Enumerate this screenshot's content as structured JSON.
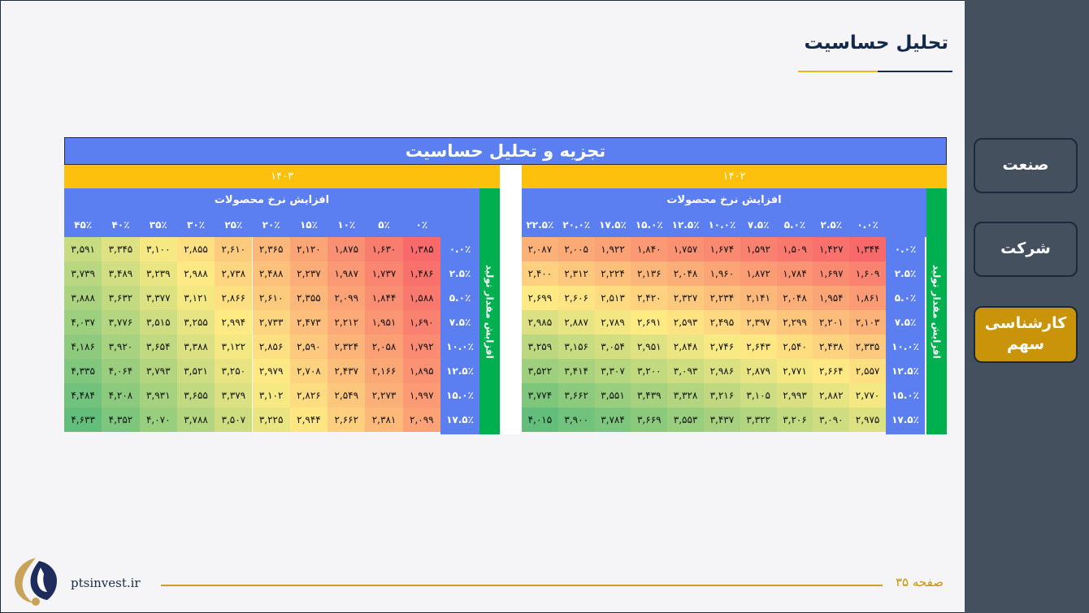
{
  "page": {
    "title": "تحلیل حساسیت",
    "footer_site": "ptsinvest.ir",
    "footer_page": "صفحه ۳۵"
  },
  "nav": {
    "items": [
      {
        "label": "صنعت",
        "active": false
      },
      {
        "label": "شرکت",
        "active": false
      },
      {
        "label": "کارشناسی\nسهم",
        "active": true
      }
    ]
  },
  "colors": {
    "header_blue": "#5b7ff0",
    "year_gold": "#fdc10d",
    "strip_green": "#00b050",
    "sidebar": "#44505e",
    "active_nav": "#c9940a",
    "scale_low": "#f8696b",
    "scale_mid": "#ffeb84",
    "scale_high": "#63be7b"
  },
  "table": {
    "title": "تجزیه و تحلیل حساسیت",
    "col_header": "افزایش نرخ محصولات",
    "row_header": "افزایش مقدار تولید",
    "row_labels": [
      "۰.۰٪",
      "۲.۵٪",
      "۵.۰٪",
      "۷.۵٪",
      "۱۰.۰٪",
      "۱۲.۵٪",
      "۱۵.۰٪",
      "۱۷.۵٪"
    ],
    "right": {
      "year": "۱۴۰۲",
      "col_labels": [
        "۰.۰٪",
        "۲.۵٪",
        "۵.۰٪",
        "۷.۵٪",
        "۱۰.۰٪",
        "۱۲.۵٪",
        "۱۵.۰٪",
        "۱۷.۵٪",
        "۲۰.۰٪",
        "۲۲.۵٪"
      ],
      "values": [
        [
          1344,
          1427,
          1509,
          1592,
          1674,
          1757,
          1840,
          1922,
          2005,
          2087
        ],
        [
          1609,
          1697,
          1784,
          1872,
          1960,
          2048,
          2136,
          2224,
          2312,
          2400
        ],
        [
          1861,
          1954,
          2048,
          2141,
          2234,
          2327,
          2420,
          2513,
          2606,
          2699
        ],
        [
          2103,
          2201,
          2299,
          2397,
          2495,
          2593,
          2691,
          2789,
          2887,
          2985
        ],
        [
          2335,
          2438,
          2540,
          2643,
          2746,
          2848,
          2951,
          3054,
          3156,
          3259
        ],
        [
          2557,
          2664,
          2771,
          2879,
          2986,
          3093,
          3200,
          3307,
          3414,
          3522
        ],
        [
          2770,
          2882,
          2993,
          3105,
          3216,
          3328,
          3439,
          3551,
          3662,
          3774
        ],
        [
          2975,
          3090,
          3206,
          3322,
          3437,
          3553,
          3669,
          3784,
          3900,
          4015
        ]
      ],
      "display": [
        [
          "۱,۳۴۴",
          "۱,۴۲۷",
          "۱,۵۰۹",
          "۱,۵۹۲",
          "۱,۶۷۴",
          "۱,۷۵۷",
          "۱,۸۴۰",
          "۱,۹۲۲",
          "۲,۰۰۵",
          "۲,۰۸۷"
        ],
        [
          "۱,۶۰۹",
          "۱,۶۹۷",
          "۱,۷۸۴",
          "۱,۸۷۲",
          "۱,۹۶۰",
          "۲,۰۴۸",
          "۲,۱۳۶",
          "۲,۲۲۴",
          "۲,۳۱۲",
          "۲,۴۰۰"
        ],
        [
          "۱,۸۶۱",
          "۱,۹۵۴",
          "۲,۰۴۸",
          "۲,۱۴۱",
          "۲,۲۳۴",
          "۲,۳۲۷",
          "۲,۴۲۰",
          "۲,۵۱۳",
          "۲,۶۰۶",
          "۲,۶۹۹"
        ],
        [
          "۲,۱۰۳",
          "۲,۲۰۱",
          "۲,۲۹۹",
          "۲,۳۹۷",
          "۲,۴۹۵",
          "۲,۵۹۳",
          "۲,۶۹۱",
          "۲,۷۸۹",
          "۲,۸۸۷",
          "۲,۹۸۵"
        ],
        [
          "۲,۳۳۵",
          "۲,۴۳۸",
          "۲,۵۴۰",
          "۲,۶۴۳",
          "۲,۷۴۶",
          "۲,۸۴۸",
          "۲,۹۵۱",
          "۳,۰۵۴",
          "۳,۱۵۶",
          "۳,۲۵۹"
        ],
        [
          "۲,۵۵۷",
          "۲,۶۶۴",
          "۲,۷۷۱",
          "۲,۸۷۹",
          "۲,۹۸۶",
          "۳,۰۹۳",
          "۳,۲۰۰",
          "۳,۳۰۷",
          "۳,۴۱۴",
          "۳,۵۲۲"
        ],
        [
          "۲,۷۷۰",
          "۲,۸۸۲",
          "۲,۹۹۳",
          "۳,۱۰۵",
          "۳,۲۱۶",
          "۳,۳۲۸",
          "۳,۴۳۹",
          "۳,۵۵۱",
          "۳,۶۶۲",
          "۳,۷۷۴"
        ],
        [
          "۲,۹۷۵",
          "۳,۰۹۰",
          "۳,۲۰۶",
          "۳,۳۲۲",
          "۳,۴۳۷",
          "۳,۵۵۳",
          "۳,۶۶۹",
          "۳,۷۸۴",
          "۳,۹۰۰",
          "۴,۰۱۵"
        ]
      ]
    },
    "left": {
      "year": "۱۴۰۳",
      "col_labels": [
        "۰٪",
        "۵٪",
        "۱۰٪",
        "۱۵٪",
        "۲۰٪",
        "۲۵٪",
        "۳۰٪",
        "۳۵٪",
        "۴۰٪",
        "۴۵٪"
      ],
      "values": [
        [
          1385,
          1630,
          1875,
          2120,
          2365,
          2610,
          2855,
          3100,
          3345,
          3591
        ],
        [
          1486,
          1737,
          1987,
          2237,
          2488,
          2738,
          2988,
          3239,
          3489,
          3739
        ],
        [
          1588,
          1844,
          2099,
          2355,
          2610,
          2866,
          3121,
          3377,
          3632,
          3888
        ],
        [
          1690,
          1951,
          2212,
          2473,
          2733,
          2994,
          3255,
          3515,
          3776,
          4037
        ],
        [
          1792,
          2058,
          2324,
          2590,
          2856,
          3122,
          3388,
          3654,
          3920,
          4186
        ],
        [
          1895,
          2166,
          2437,
          2708,
          2979,
          3250,
          3521,
          3793,
          4064,
          4335
        ],
        [
          1997,
          2273,
          2549,
          2826,
          3102,
          3379,
          3655,
          3931,
          4208,
          4484
        ],
        [
          2099,
          2381,
          2662,
          2944,
          3225,
          3507,
          3788,
          4070,
          4352,
          4633
        ]
      ],
      "display": [
        [
          "۱,۳۸۵",
          "۱,۶۳۰",
          "۱,۸۷۵",
          "۲,۱۲۰",
          "۲,۳۶۵",
          "۲,۶۱۰",
          "۲,۸۵۵",
          "۳,۱۰۰",
          "۳,۳۴۵",
          "۳,۵۹۱"
        ],
        [
          "۱,۴۸۶",
          "۱,۷۳۷",
          "۱,۹۸۷",
          "۲,۲۳۷",
          "۲,۴۸۸",
          "۲,۷۳۸",
          "۲,۹۸۸",
          "۳,۲۳۹",
          "۳,۴۸۹",
          "۳,۷۳۹"
        ],
        [
          "۱,۵۸۸",
          "۱,۸۴۴",
          "۲,۰۹۹",
          "۲,۳۵۵",
          "۲,۶۱۰",
          "۲,۸۶۶",
          "۳,۱۲۱",
          "۳,۳۷۷",
          "۳,۶۳۲",
          "۳,۸۸۸"
        ],
        [
          "۱,۶۹۰",
          "۱,۹۵۱",
          "۲,۲۱۲",
          "۲,۴۷۳",
          "۲,۷۳۳",
          "۲,۹۹۴",
          "۳,۲۵۵",
          "۳,۵۱۵",
          "۳,۷۷۶",
          "۴,۰۳۷"
        ],
        [
          "۱,۷۹۲",
          "۲,۰۵۸",
          "۲,۳۲۴",
          "۲,۵۹۰",
          "۲,۸۵۶",
          "۳,۱۲۲",
          "۳,۳۸۸",
          "۳,۶۵۴",
          "۳,۹۲۰",
          "۴,۱۸۶"
        ],
        [
          "۱,۸۹۵",
          "۲,۱۶۶",
          "۲,۴۳۷",
          "۲,۷۰۸",
          "۲,۹۷۹",
          "۳,۲۵۰",
          "۳,۵۲۱",
          "۳,۷۹۳",
          "۴,۰۶۴",
          "۴,۳۳۵"
        ],
        [
          "۱,۹۹۷",
          "۲,۲۷۳",
          "۲,۵۴۹",
          "۲,۸۲۶",
          "۳,۱۰۲",
          "۳,۳۷۹",
          "۳,۶۵۵",
          "۳,۹۳۱",
          "۴,۲۰۸",
          "۴,۴۸۴"
        ],
        [
          "۲,۰۹۹",
          "۲,۳۸۱",
          "۲,۶۶۲",
          "۲,۹۴۴",
          "۳,۲۲۵",
          "۳,۵۰۷",
          "۳,۷۸۸",
          "۴,۰۷۰",
          "۴,۳۵۲",
          "۴,۶۳۳"
        ]
      ]
    }
  }
}
